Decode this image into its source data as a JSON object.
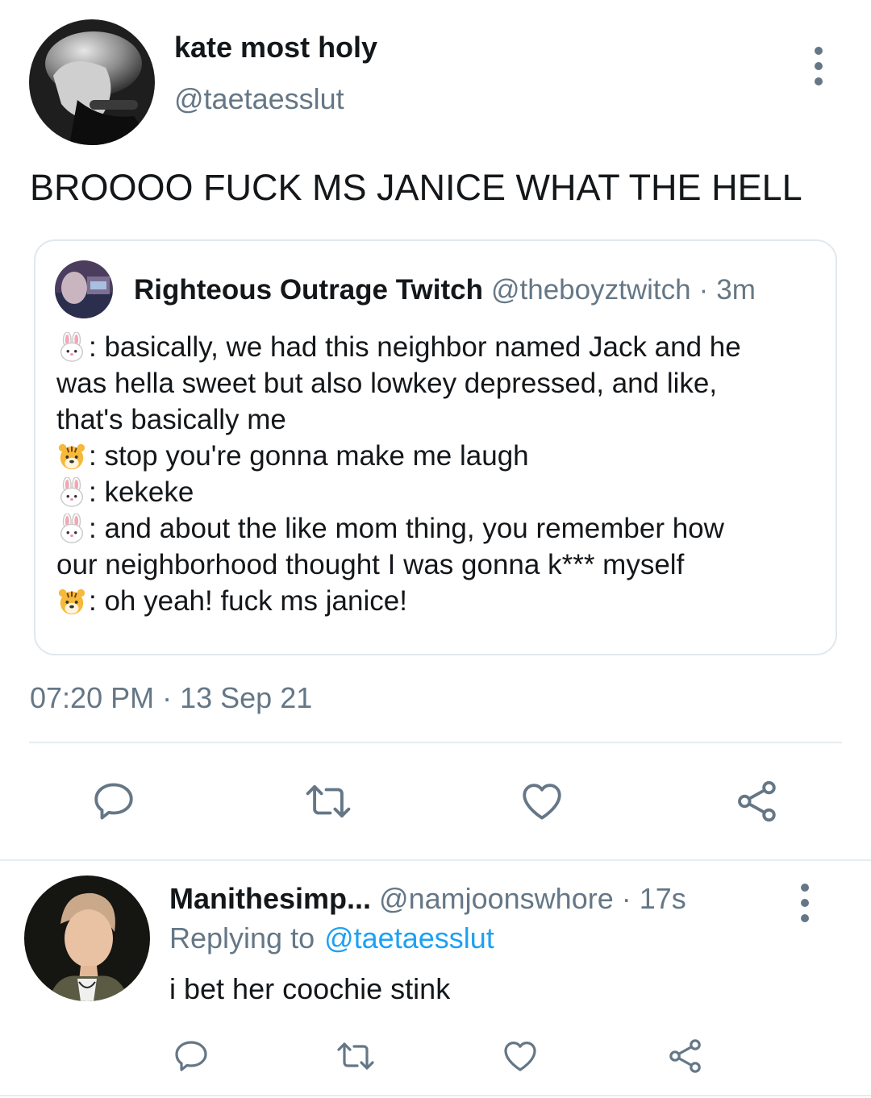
{
  "tweet": {
    "author_name": "kate most holy",
    "author_handle": "@taetaesslut",
    "text": "BROOOO FUCK MS JANICE WHAT THE HELL",
    "time": "07:20 PM",
    "sep": "·",
    "date": "13 Sep 21"
  },
  "quoted": {
    "author_name": "Righteous Outrage Twitch",
    "author_handle": "@theboyztwitch",
    "sep": "·",
    "age": "3m",
    "lines": [
      {
        "emoji": "rabbit-face",
        "text": ": basically, we had this neighbor named Jack and he"
      },
      {
        "emoji": "",
        "text": "was hella sweet but also lowkey depressed, and like,"
      },
      {
        "emoji": "",
        "text": "that's basically me"
      },
      {
        "emoji": "tiger-face",
        "text": ": stop you're gonna make me laugh"
      },
      {
        "emoji": "rabbit-face",
        "text": ": kekeke"
      },
      {
        "emoji": "rabbit-face",
        "text": ": and about the like mom thing, you remember how"
      },
      {
        "emoji": "",
        "text": "our neighborhood thought I was gonna k*** myself"
      },
      {
        "emoji": "tiger-face",
        "text": ": oh yeah! fuck ms janice!"
      }
    ]
  },
  "reply": {
    "author_name": "Manithesimp...",
    "author_handle": "@namjoonswhore",
    "sep": "·",
    "age": "17s",
    "replying_prefix": "Replying to",
    "replying_to": "@taetaesslut",
    "text": "i bet her coochie stink"
  },
  "icons": {
    "reply": "reply-icon",
    "retweet": "retweet-icon",
    "like": "heart-icon",
    "share": "share-icon",
    "more": "more-vert-icon"
  },
  "colors": {
    "text": "#14171a",
    "secondary": "#657786",
    "link": "#1da1f2",
    "border": "#e1e8ed"
  }
}
